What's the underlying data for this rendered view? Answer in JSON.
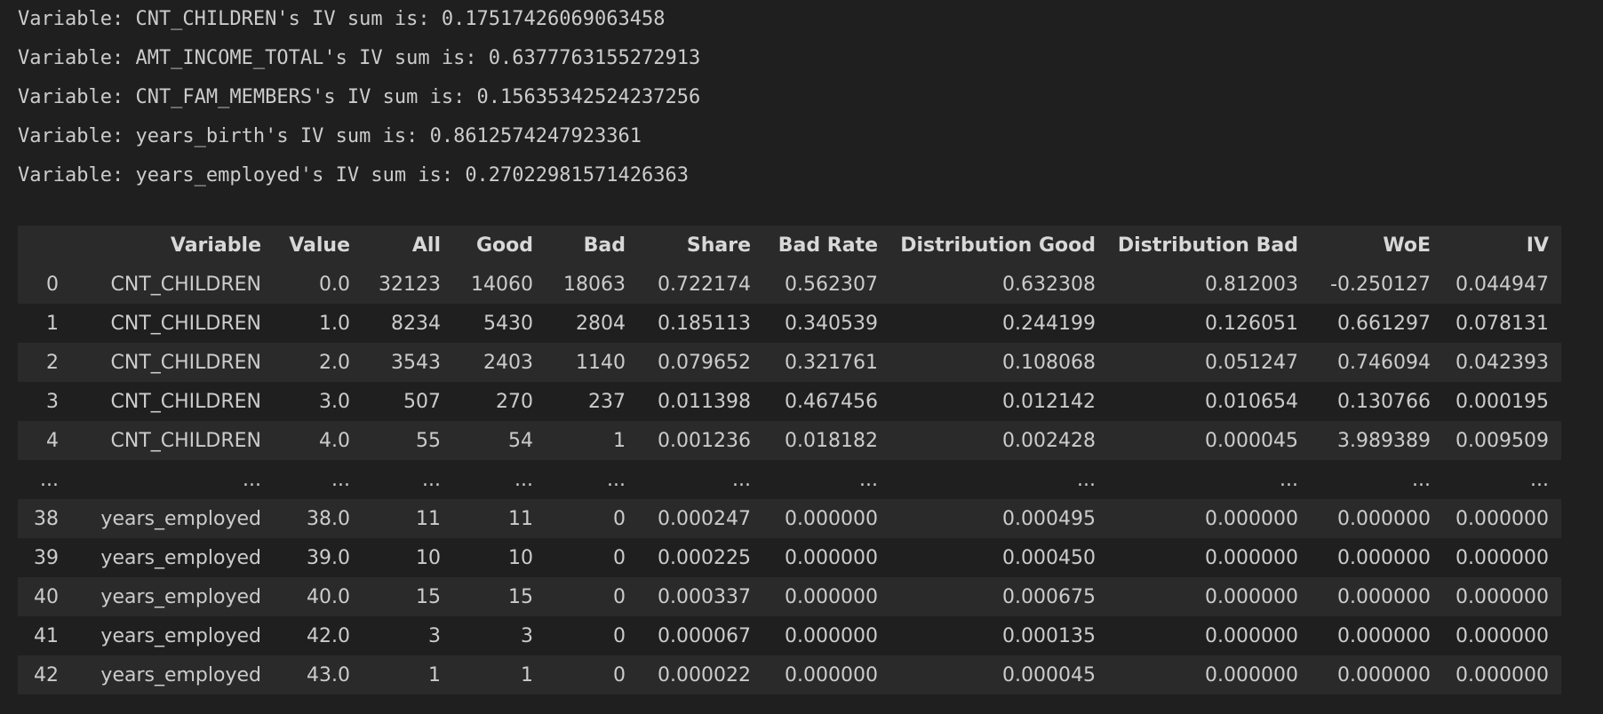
{
  "stream_lines": [
    "Variable: CNT_CHILDREN's IV sum is: 0.17517426069063458",
    "Variable: AMT_INCOME_TOTAL's IV sum is: 0.6377763155272913",
    "Variable: CNT_FAM_MEMBERS's IV sum is: 0.15635342524237256",
    "Variable: years_birth's IV sum is: 0.8612574247923361",
    "Variable: years_employed's IV sum is: 0.27022981571426363"
  ],
  "table": {
    "columns": [
      "",
      "Variable",
      "Value",
      "All",
      "Good",
      "Bad",
      "Share",
      "Bad Rate",
      "Distribution Good",
      "Distribution Bad",
      "WoE",
      "IV"
    ],
    "rows": [
      [
        "0",
        "CNT_CHILDREN",
        "0.0",
        "32123",
        "14060",
        "18063",
        "0.722174",
        "0.562307",
        "0.632308",
        "0.812003",
        "-0.250127",
        "0.044947"
      ],
      [
        "1",
        "CNT_CHILDREN",
        "1.0",
        "8234",
        "5430",
        "2804",
        "0.185113",
        "0.340539",
        "0.244199",
        "0.126051",
        "0.661297",
        "0.078131"
      ],
      [
        "2",
        "CNT_CHILDREN",
        "2.0",
        "3543",
        "2403",
        "1140",
        "0.079652",
        "0.321761",
        "0.108068",
        "0.051247",
        "0.746094",
        "0.042393"
      ],
      [
        "3",
        "CNT_CHILDREN",
        "3.0",
        "507",
        "270",
        "237",
        "0.011398",
        "0.467456",
        "0.012142",
        "0.010654",
        "0.130766",
        "0.000195"
      ],
      [
        "4",
        "CNT_CHILDREN",
        "4.0",
        "55",
        "54",
        "1",
        "0.001236",
        "0.018182",
        "0.002428",
        "0.000045",
        "3.989389",
        "0.009509"
      ],
      [
        "...",
        "...",
        "...",
        "...",
        "...",
        "...",
        "...",
        "...",
        "...",
        "...",
        "...",
        "..."
      ],
      [
        "38",
        "years_employed",
        "38.0",
        "11",
        "11",
        "0",
        "0.000247",
        "0.000000",
        "0.000495",
        "0.000000",
        "0.000000",
        "0.000000"
      ],
      [
        "39",
        "years_employed",
        "39.0",
        "10",
        "10",
        "0",
        "0.000225",
        "0.000000",
        "0.000450",
        "0.000000",
        "0.000000",
        "0.000000"
      ],
      [
        "40",
        "years_employed",
        "40.0",
        "15",
        "15",
        "0",
        "0.000337",
        "0.000000",
        "0.000675",
        "0.000000",
        "0.000000",
        "0.000000"
      ],
      [
        "41",
        "years_employed",
        "42.0",
        "3",
        "3",
        "0",
        "0.000067",
        "0.000000",
        "0.000135",
        "0.000000",
        "0.000000",
        "0.000000"
      ],
      [
        "42",
        "years_employed",
        "43.0",
        "1",
        "1",
        "0",
        "0.000022",
        "0.000000",
        "0.000045",
        "0.000000",
        "0.000000",
        "0.000000"
      ]
    ]
  }
}
